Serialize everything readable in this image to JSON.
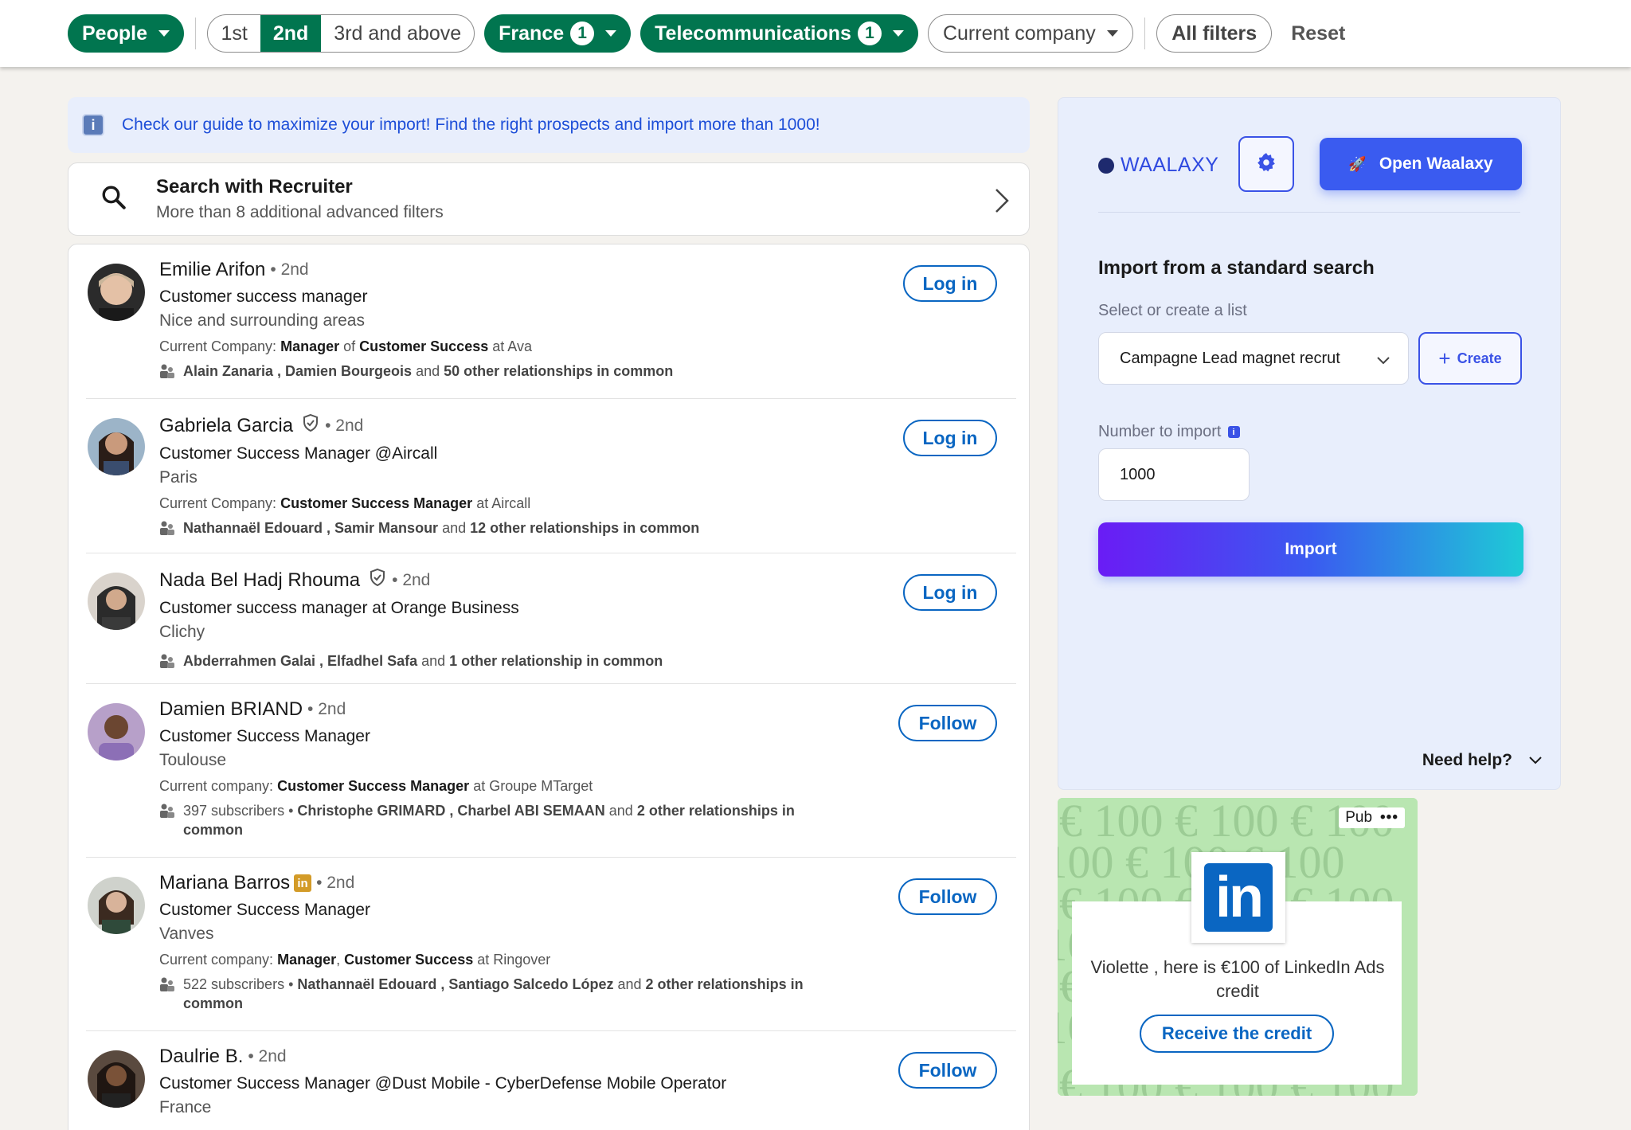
{
  "filters": {
    "people": "People",
    "degrees": [
      "1st",
      "2nd",
      "3rd and above"
    ],
    "location": "France",
    "location_count": "1",
    "industry": "Telecommunications",
    "industry_count": "1",
    "current_company": "Current company",
    "all_filters": "All filters",
    "reset": "Reset"
  },
  "banner": {
    "text": "Check our guide to maximize your import! Find the right prospects and import more than 1000!"
  },
  "recruiter": {
    "title": "Search with Recruiter",
    "subtitle": "More than 8 additional advanced filters"
  },
  "results": [
    {
      "name": "Emilie Arifon",
      "degree": "• 2nd",
      "headline": "Customer success manager",
      "location": "Nice and surrounding areas",
      "company_prefix": "Current Company:",
      "company_role": "Manager",
      "company_of": "of",
      "company_dept": "Customer Success",
      "company_at": "at Ava",
      "mutual_names": "Alain Zanaria , Damien Bourgeois",
      "mutual_and": "and",
      "mutual_rest": "50 other relationships in common",
      "action": "Log in"
    },
    {
      "name": "Gabriela Garcia",
      "degree": "• 2nd",
      "headline": "Customer Success Manager @Aircall",
      "location": "Paris",
      "company_prefix": "Current Company:",
      "company_role": "Customer Success Manager",
      "company_at": "at Aircall",
      "mutual_names": "Nathannaël Edouard , Samir Mansour",
      "mutual_and": "and",
      "mutual_rest": "12 other relationships in common",
      "action": "Log in"
    },
    {
      "name": "Nada Bel Hadj Rhouma",
      "degree": "• 2nd",
      "headline": "Customer success manager at Orange Business",
      "location": "Clichy",
      "mutual_names": "Abderrahmen Galai , Elfadhel Safa",
      "mutual_and": "and",
      "mutual_rest": "1 other relationship in common",
      "action": "Log in"
    },
    {
      "name": "Damien BRIAND",
      "degree": "• 2nd",
      "headline": "Customer Success Manager",
      "location": "Toulouse",
      "company_prefix": "Current company:",
      "company_role": "Customer Success Manager",
      "company_at": "at Groupe MTarget",
      "subscribers": "397 subscribers •",
      "mutual_names": "Christophe GRIMARD , Charbel ABI SEMAAN",
      "mutual_and": "and",
      "mutual_rest": "2 other relationships in common",
      "action": "Follow"
    },
    {
      "name": "Mariana Barros",
      "degree": "• 2nd",
      "headline": "Customer Success Manager",
      "location": "Vanves",
      "company_prefix": "Current company:",
      "company_role": "Manager",
      "company_sep": ",",
      "company_dept": "Customer Success",
      "company_at": "at Ringover",
      "subscribers": "522 subscribers •",
      "mutual_names": "Nathannaël Edouard , Santiago Salcedo López",
      "mutual_and": "and",
      "mutual_rest": "2 other relationships in common",
      "action": "Follow"
    },
    {
      "name": "Daulrie B.",
      "degree": "• 2nd",
      "headline": "Customer Success Manager @Dust Mobile - CyberDefense Mobile Operator",
      "location": "France",
      "action": "Follow"
    }
  ],
  "waalaxy": {
    "logo": "WAALAXY",
    "open_label": "Open Waalaxy",
    "title": "Import from a standard search",
    "list_label": "Select or create a list",
    "list_value": "Campagne Lead magnet recrut",
    "create_label": "Create",
    "number_label": "Number to import",
    "number_value": "1000",
    "import_label": "Import",
    "help_label": "Need help?"
  },
  "ad": {
    "pub": "Pub",
    "dots": "•••",
    "bg_text": "€ 100 € 100 € 100",
    "logo_text": "in",
    "text": "Violette , here is €100 of LinkedIn Ads credit",
    "button": "Receive the credit"
  },
  "colors": {
    "linkedin_green": "#01754f",
    "linkedin_blue": "#0a66c2",
    "waalaxy_blue": "#3a5bf0",
    "waalaxy_panel": "#e8eefc"
  }
}
